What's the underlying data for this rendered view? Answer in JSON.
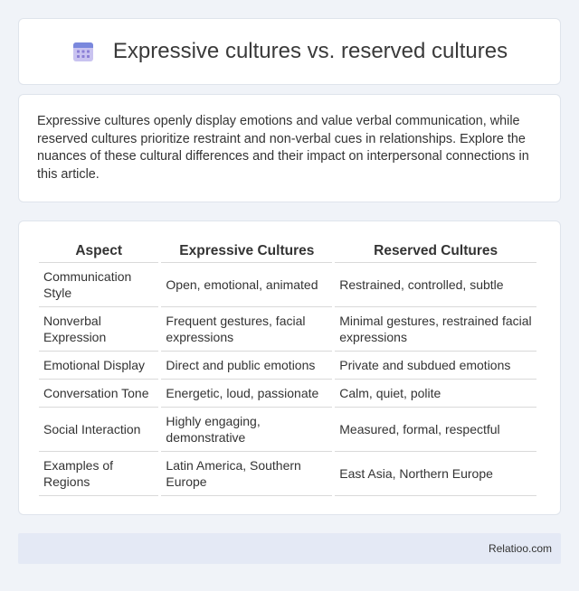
{
  "header": {
    "icon": "calendar-icon",
    "title": "Expressive cultures vs. reserved cultures"
  },
  "intro": {
    "text": "Expressive cultures openly display emotions and value verbal communication, while reserved cultures prioritize restraint and non-verbal cues in relationships. Explore the nuances of these cultural differences and their impact on interpersonal connections in this article."
  },
  "table": {
    "headers": [
      "Aspect",
      "Expressive Cultures",
      "Reserved Cultures"
    ],
    "rows": [
      [
        "Communication Style",
        "Open, emotional, animated",
        "Restrained, controlled, subtle"
      ],
      [
        "Nonverbal Expression",
        "Frequent gestures, facial expressions",
        "Minimal gestures, restrained facial expressions"
      ],
      [
        "Emotional Display",
        "Direct and public emotions",
        "Private and subdued emotions"
      ],
      [
        "Conversation Tone",
        "Energetic, loud, passionate",
        "Calm, quiet, polite"
      ],
      [
        "Social Interaction",
        "Highly engaging, demonstrative",
        "Measured, formal, respectful"
      ],
      [
        "Examples of Regions",
        "Latin America, Southern Europe",
        "East Asia, Northern Europe"
      ]
    ]
  },
  "footer": {
    "site": "Relatioo.com"
  },
  "colors": {
    "page_background": "#f0f3f8",
    "card_background": "#ffffff",
    "footer_background": "#e4e9f5",
    "icon_accent": "#8b7fd6"
  }
}
